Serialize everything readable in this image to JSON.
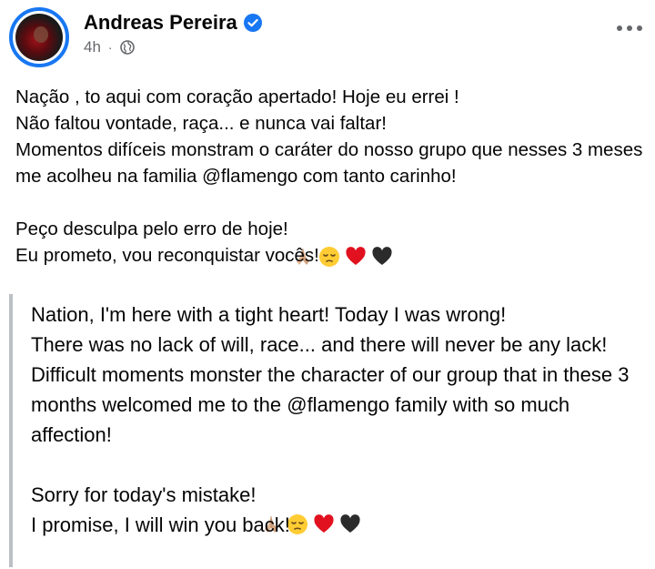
{
  "post": {
    "author": "Andreas Pereira",
    "time": "4h",
    "separator": "·",
    "audience_icon": "globe-icon",
    "verified_icon": "verified-badge-icon",
    "menu_icon": "more-options-icon",
    "brand_color": "#1877f2"
  },
  "original": {
    "line1": "Nação , to aqui com coração apertado! Hoje eu errei !",
    "line2": "Não faltou vontade, raça... e nunca vai faltar!",
    "line3": "Momentos difíceis monstram o caráter do nosso grupo que nesses 3 meses me acolheu na familia @flamengo com tanto carinho!",
    "line4": "Peço desculpa pelo erro de hoje!",
    "line5": "Eu prometo, vou reconquistar vocês!",
    "emojis": [
      "folded-hands",
      "pensive-face",
      "red-heart",
      "black-heart"
    ]
  },
  "translation": {
    "line1": "Nation, I'm here with a tight heart! Today I was wrong!",
    "line2": "There was no lack of will, race... and there will never be any lack!",
    "line3": "Difficult moments monster the character of our group that in these 3 months welcomed me to the @flamengo family with so much affection!",
    "line4": "Sorry for today's mistake!",
    "line5": "I promise, I will win you back!",
    "emojis": [
      "folded-hands",
      "pensive-face",
      "red-heart",
      "black-heart"
    ]
  }
}
